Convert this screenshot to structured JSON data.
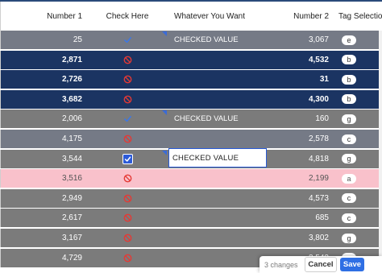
{
  "columns": {
    "number1": "Number 1",
    "check": "Check Here",
    "whatever": "Whatever You Want",
    "number2": "Number 2",
    "tag": "Tag Selection"
  },
  "rows": [
    {
      "number1": "25",
      "check": "check",
      "whatever": "CHECKED VALUE",
      "number2": "3,067",
      "tag": "e",
      "theme": "slate"
    },
    {
      "number1": "2,871",
      "check": "forbidden",
      "whatever": "",
      "number2": "4,532",
      "tag": "b",
      "theme": "navy"
    },
    {
      "number1": "2,726",
      "check": "forbidden",
      "whatever": "",
      "number2": "31",
      "tag": "b",
      "theme": "navy"
    },
    {
      "number1": "3,682",
      "check": "forbidden",
      "whatever": "",
      "number2": "4,300",
      "tag": "b",
      "theme": "navy"
    },
    {
      "number1": "2,006",
      "check": "check",
      "whatever": "CHECKED VALUE",
      "number2": "160",
      "tag": "g",
      "theme": "gray"
    },
    {
      "number1": "4,175",
      "check": "forbidden",
      "whatever": "",
      "number2": "2,578",
      "tag": "c",
      "theme": "slate"
    },
    {
      "number1": "3,544",
      "check": "checkbox",
      "whatever": "CHECKED VALUE",
      "number2": "4,818",
      "tag": "g",
      "theme": "gray"
    },
    {
      "number1": "3,516",
      "check": "forbidden",
      "whatever": "",
      "number2": "2,199",
      "tag": "a",
      "theme": "pink"
    },
    {
      "number1": "2,949",
      "check": "forbidden",
      "whatever": "",
      "number2": "4,573",
      "tag": "c",
      "theme": "gray"
    },
    {
      "number1": "2,617",
      "check": "forbidden",
      "whatever": "",
      "number2": "685",
      "tag": "c",
      "theme": "gray"
    },
    {
      "number1": "3,167",
      "check": "forbidden",
      "whatever": "",
      "number2": "3,802",
      "tag": "g",
      "theme": "gray"
    },
    {
      "number1": "4,729",
      "check": "forbidden",
      "whatever": "",
      "number2": "3,542",
      "tag": "c",
      "theme": "gray"
    }
  ],
  "edit_cell_value": "CHECKED VALUE",
  "footer": {
    "changes": "3 changes",
    "cancel": "Cancel",
    "save": "Save"
  },
  "colors": {
    "accent": "#2f6fe4",
    "forbidden": "#e53935",
    "navy_row": "#1b3462",
    "slate_row": "#757a86",
    "gray_row": "#7b7b7b",
    "pink_row": "#f9c1cb"
  },
  "icons": {
    "check": "check-icon",
    "forbidden": "forbidden-icon",
    "checkbox": "checkbox-checked-icon"
  }
}
